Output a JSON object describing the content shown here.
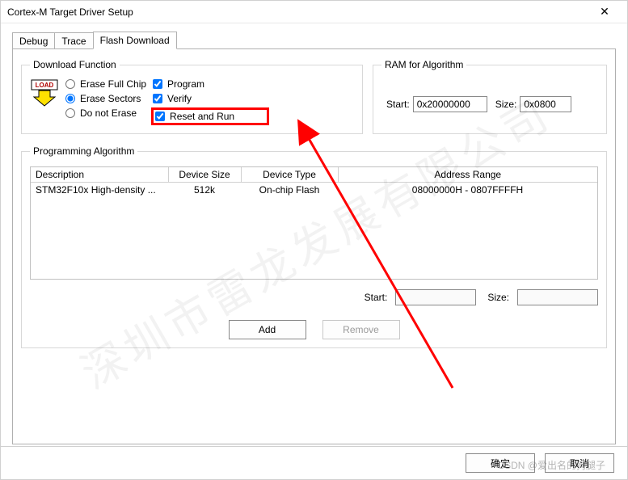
{
  "window": {
    "title": "Cortex-M Target Driver Setup",
    "close_glyph": "✕"
  },
  "tabs": {
    "items": [
      {
        "label": "Debug",
        "active": false
      },
      {
        "label": "Trace",
        "active": false
      },
      {
        "label": "Flash Download",
        "active": true
      }
    ]
  },
  "download_function": {
    "legend": "Download Function",
    "load_icon_text": "LOAD",
    "radios": [
      {
        "label": "Erase Full Chip",
        "checked": false
      },
      {
        "label": "Erase Sectors",
        "checked": true
      },
      {
        "label": "Do not Erase",
        "checked": false
      }
    ],
    "checks": [
      {
        "label": "Program",
        "checked": true,
        "highlight": false
      },
      {
        "label": "Verify",
        "checked": true,
        "highlight": false
      },
      {
        "label": "Reset and Run",
        "checked": true,
        "highlight": true
      }
    ]
  },
  "ram_algorithm": {
    "legend": "RAM for Algorithm",
    "start_label": "Start:",
    "start_value": "0x20000000",
    "size_label": "Size:",
    "size_value": "0x0800"
  },
  "programming_algorithm": {
    "legend": "Programming Algorithm",
    "columns": [
      "Description",
      "Device Size",
      "Device Type",
      "Address Range"
    ],
    "rows": [
      {
        "description": "STM32F10x High-density ...",
        "device_size": "512k",
        "device_type": "On-chip Flash",
        "address_range": "08000000H - 0807FFFFH"
      }
    ],
    "start_label": "Start:",
    "start_value": "",
    "size_label": "Size:",
    "size_value": "",
    "add_label": "Add",
    "remove_label": "Remove"
  },
  "dialog_buttons": {
    "ok": "确定",
    "cancel": "取消"
  },
  "watermark": {
    "diagonal": "深圳市雷龙发展有限公司",
    "footer": "CSDN @爱出名的狗腿子"
  }
}
